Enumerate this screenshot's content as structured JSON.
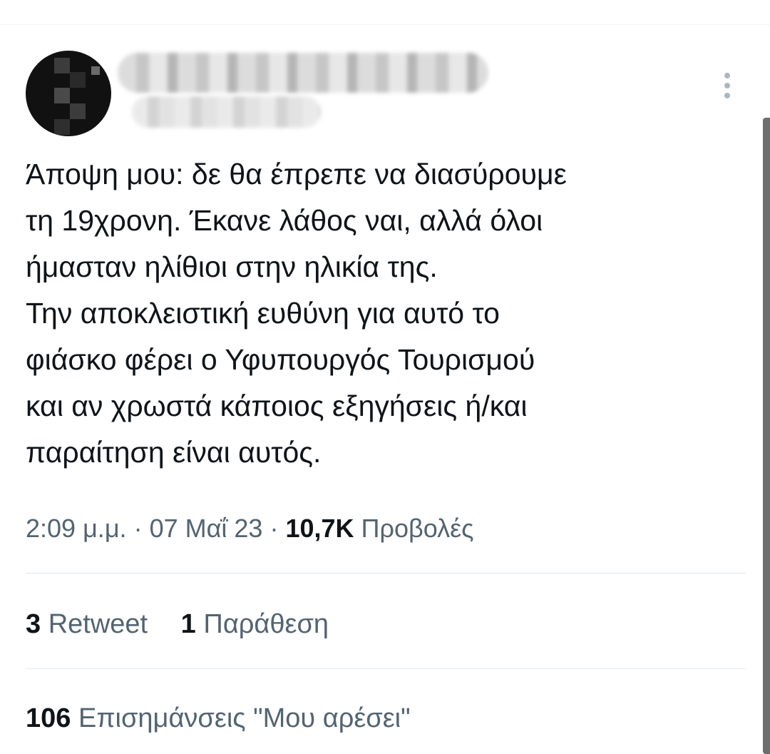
{
  "tweet": {
    "lines": [
      "Άποψη μου: δε θα έπρεπε να διασύρουμε",
      "τη 19χρονη. Έκανε λάθος ναι, αλλά όλοι",
      "ήμασταν ηλίθιοι στην ηλικία της.",
      "Την αποκλειστική ευθύνη για αυτό το",
      "φιάσκο φέρει ο Υφυπουργός Τουρισμού",
      "και αν χρωστά κάποιος εξηγήσεις ή/και",
      "παραίτηση είναι αυτός."
    ]
  },
  "meta": {
    "time": "2:09 μ.μ.",
    "separator": " · ",
    "date": "07 Μαΐ 23",
    "views_count": "10,7K",
    "views_label": "Προβολές"
  },
  "stats": {
    "retweets_count": "3",
    "retweets_label": "Retweet",
    "quotes_count": "1",
    "quotes_label": "Παράθεση",
    "likes_count": "106",
    "likes_label": "Επισημάνσεις \"Μου αρέσει\""
  },
  "icons": {
    "more": "more-vertical-icon"
  },
  "colors": {
    "text": "#0f1419",
    "secondary": "#536471",
    "divider": "#e1e8ed"
  }
}
